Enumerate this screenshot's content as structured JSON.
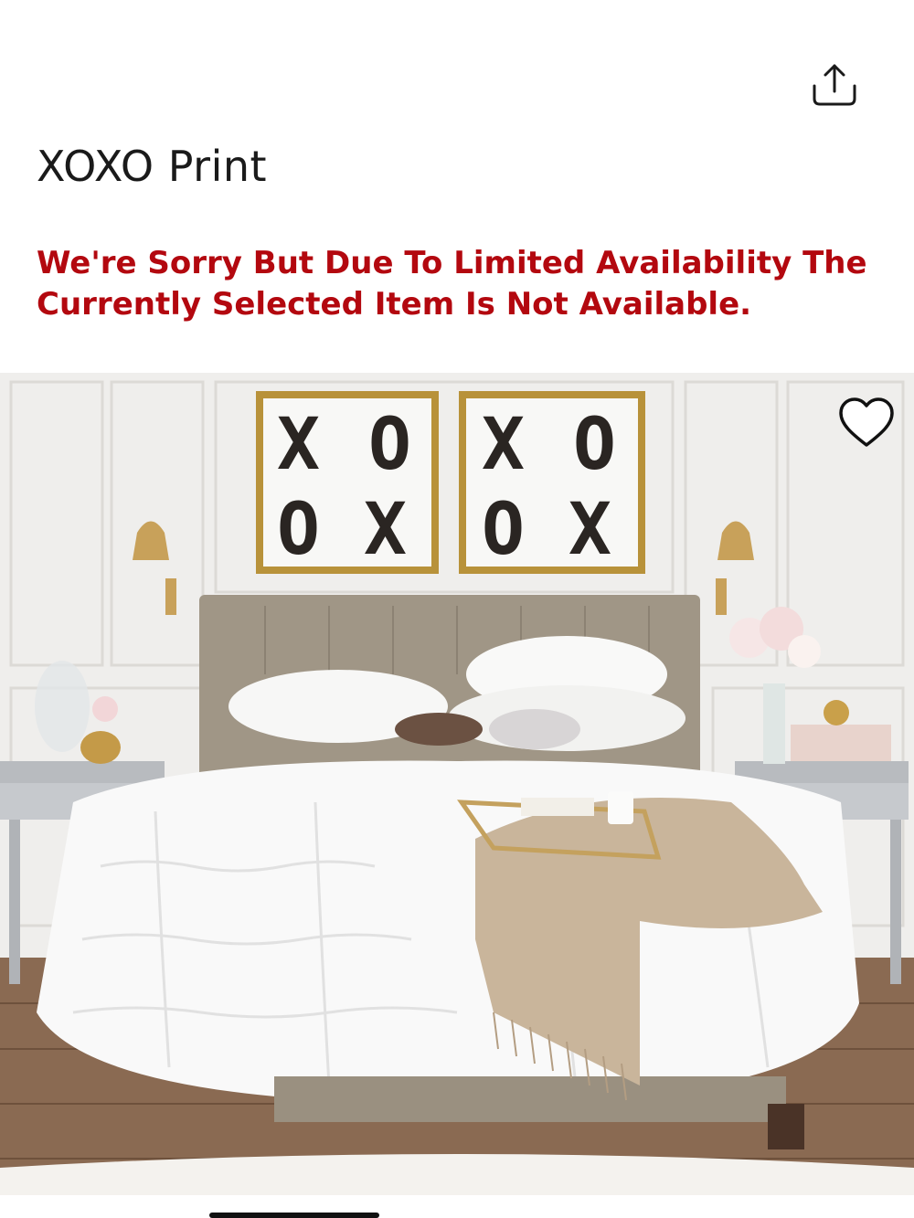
{
  "product": {
    "title": "XOXO Print",
    "availability_message": "We're Sorry But Due To Limited Availability The Currently Selected Item Is Not Available.",
    "image_alt": "Bedroom with two framed XOXO prints above an upholstered bed"
  },
  "actions": {
    "share_icon": "share-icon",
    "favorite_icon": "heart-icon"
  },
  "artwork": {
    "print_text": [
      "X",
      "O",
      "O",
      "X"
    ]
  },
  "colors": {
    "alert_red": "#b3080f",
    "title_text": "#1a1a1a"
  }
}
